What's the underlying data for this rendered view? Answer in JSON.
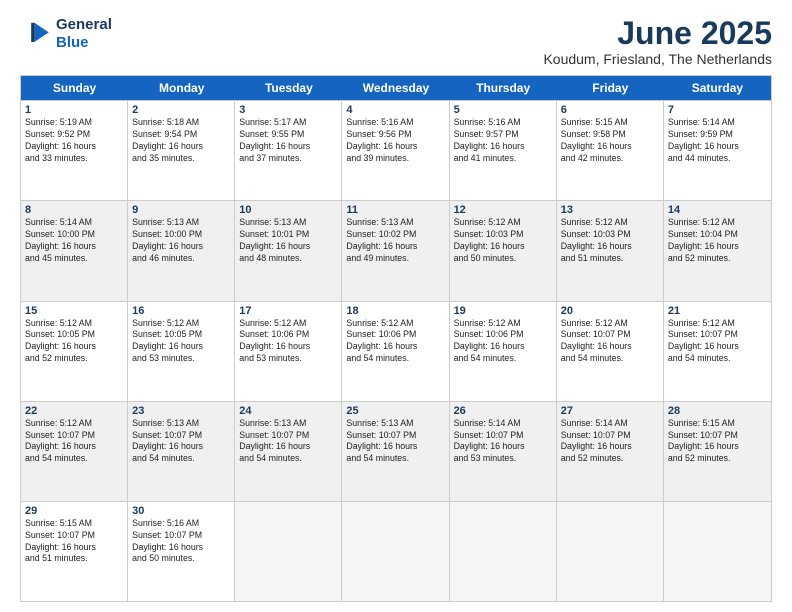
{
  "logo": {
    "line1": "General",
    "line2": "Blue"
  },
  "title": "June 2025",
  "location": "Koudum, Friesland, The Netherlands",
  "days_of_week": [
    "Sunday",
    "Monday",
    "Tuesday",
    "Wednesday",
    "Thursday",
    "Friday",
    "Saturday"
  ],
  "weeks": [
    [
      {
        "day": "1",
        "text": "Sunrise: 5:19 AM\nSunset: 9:52 PM\nDaylight: 16 hours\nand 33 minutes.",
        "shaded": false
      },
      {
        "day": "2",
        "text": "Sunrise: 5:18 AM\nSunset: 9:54 PM\nDaylight: 16 hours\nand 35 minutes.",
        "shaded": false
      },
      {
        "day": "3",
        "text": "Sunrise: 5:17 AM\nSunset: 9:55 PM\nDaylight: 16 hours\nand 37 minutes.",
        "shaded": false
      },
      {
        "day": "4",
        "text": "Sunrise: 5:16 AM\nSunset: 9:56 PM\nDaylight: 16 hours\nand 39 minutes.",
        "shaded": false
      },
      {
        "day": "5",
        "text": "Sunrise: 5:16 AM\nSunset: 9:57 PM\nDaylight: 16 hours\nand 41 minutes.",
        "shaded": false
      },
      {
        "day": "6",
        "text": "Sunrise: 5:15 AM\nSunset: 9:58 PM\nDaylight: 16 hours\nand 42 minutes.",
        "shaded": false
      },
      {
        "day": "7",
        "text": "Sunrise: 5:14 AM\nSunset: 9:59 PM\nDaylight: 16 hours\nand 44 minutes.",
        "shaded": false
      }
    ],
    [
      {
        "day": "8",
        "text": "Sunrise: 5:14 AM\nSunset: 10:00 PM\nDaylight: 16 hours\nand 45 minutes.",
        "shaded": true
      },
      {
        "day": "9",
        "text": "Sunrise: 5:13 AM\nSunset: 10:00 PM\nDaylight: 16 hours\nand 46 minutes.",
        "shaded": true
      },
      {
        "day": "10",
        "text": "Sunrise: 5:13 AM\nSunset: 10:01 PM\nDaylight: 16 hours\nand 48 minutes.",
        "shaded": true
      },
      {
        "day": "11",
        "text": "Sunrise: 5:13 AM\nSunset: 10:02 PM\nDaylight: 16 hours\nand 49 minutes.",
        "shaded": true
      },
      {
        "day": "12",
        "text": "Sunrise: 5:12 AM\nSunset: 10:03 PM\nDaylight: 16 hours\nand 50 minutes.",
        "shaded": true
      },
      {
        "day": "13",
        "text": "Sunrise: 5:12 AM\nSunset: 10:03 PM\nDaylight: 16 hours\nand 51 minutes.",
        "shaded": true
      },
      {
        "day": "14",
        "text": "Sunrise: 5:12 AM\nSunset: 10:04 PM\nDaylight: 16 hours\nand 52 minutes.",
        "shaded": true
      }
    ],
    [
      {
        "day": "15",
        "text": "Sunrise: 5:12 AM\nSunset: 10:05 PM\nDaylight: 16 hours\nand 52 minutes.",
        "shaded": false
      },
      {
        "day": "16",
        "text": "Sunrise: 5:12 AM\nSunset: 10:05 PM\nDaylight: 16 hours\nand 53 minutes.",
        "shaded": false
      },
      {
        "day": "17",
        "text": "Sunrise: 5:12 AM\nSunset: 10:06 PM\nDaylight: 16 hours\nand 53 minutes.",
        "shaded": false
      },
      {
        "day": "18",
        "text": "Sunrise: 5:12 AM\nSunset: 10:06 PM\nDaylight: 16 hours\nand 54 minutes.",
        "shaded": false
      },
      {
        "day": "19",
        "text": "Sunrise: 5:12 AM\nSunset: 10:06 PM\nDaylight: 16 hours\nand 54 minutes.",
        "shaded": false
      },
      {
        "day": "20",
        "text": "Sunrise: 5:12 AM\nSunset: 10:07 PM\nDaylight: 16 hours\nand 54 minutes.",
        "shaded": false
      },
      {
        "day": "21",
        "text": "Sunrise: 5:12 AM\nSunset: 10:07 PM\nDaylight: 16 hours\nand 54 minutes.",
        "shaded": false
      }
    ],
    [
      {
        "day": "22",
        "text": "Sunrise: 5:12 AM\nSunset: 10:07 PM\nDaylight: 16 hours\nand 54 minutes.",
        "shaded": true
      },
      {
        "day": "23",
        "text": "Sunrise: 5:13 AM\nSunset: 10:07 PM\nDaylight: 16 hours\nand 54 minutes.",
        "shaded": true
      },
      {
        "day": "24",
        "text": "Sunrise: 5:13 AM\nSunset: 10:07 PM\nDaylight: 16 hours\nand 54 minutes.",
        "shaded": true
      },
      {
        "day": "25",
        "text": "Sunrise: 5:13 AM\nSunset: 10:07 PM\nDaylight: 16 hours\nand 54 minutes.",
        "shaded": true
      },
      {
        "day": "26",
        "text": "Sunrise: 5:14 AM\nSunset: 10:07 PM\nDaylight: 16 hours\nand 53 minutes.",
        "shaded": true
      },
      {
        "day": "27",
        "text": "Sunrise: 5:14 AM\nSunset: 10:07 PM\nDaylight: 16 hours\nand 52 minutes.",
        "shaded": true
      },
      {
        "day": "28",
        "text": "Sunrise: 5:15 AM\nSunset: 10:07 PM\nDaylight: 16 hours\nand 52 minutes.",
        "shaded": true
      }
    ],
    [
      {
        "day": "29",
        "text": "Sunrise: 5:15 AM\nSunset: 10:07 PM\nDaylight: 16 hours\nand 51 minutes.",
        "shaded": false
      },
      {
        "day": "30",
        "text": "Sunrise: 5:16 AM\nSunset: 10:07 PM\nDaylight: 16 hours\nand 50 minutes.",
        "shaded": false
      },
      {
        "day": "",
        "text": "",
        "shaded": true,
        "empty": true
      },
      {
        "day": "",
        "text": "",
        "shaded": true,
        "empty": true
      },
      {
        "day": "",
        "text": "",
        "shaded": true,
        "empty": true
      },
      {
        "day": "",
        "text": "",
        "shaded": true,
        "empty": true
      },
      {
        "day": "",
        "text": "",
        "shaded": true,
        "empty": true
      }
    ]
  ]
}
